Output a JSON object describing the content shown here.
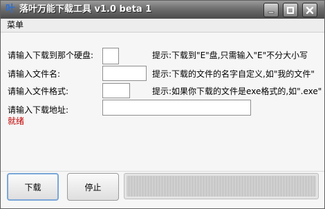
{
  "window": {
    "title": "落叶万能下载工具 v1.0 beta 1",
    "app_icon_glyph": "叶",
    "controls": {
      "minimize": "minimize-icon",
      "maximize": "maximize-icon",
      "close": "close-icon"
    }
  },
  "menu": {
    "items": [
      {
        "label": "菜单"
      }
    ]
  },
  "form": {
    "drive": {
      "label": "请输入下载到那个硬盘:",
      "value": "",
      "tip": "提示:下载到\"E\"盘,只需输入\"E\"不分大小写"
    },
    "filename": {
      "label": "请输入文件名:",
      "value": "",
      "tip": "提示:下载的文件的名字自定义,如\"我的文件\""
    },
    "format": {
      "label": "请输入文件格式:",
      "value": "",
      "tip": "提示:如果你下载的文件是exe格式的,如\".exe\""
    },
    "url": {
      "label": "请输入下载地址:",
      "value": ""
    }
  },
  "status": {
    "text": "就绪",
    "color": "#c00000"
  },
  "buttons": {
    "download": "下载",
    "stop": "停止"
  },
  "progress": {
    "value": 0
  }
}
